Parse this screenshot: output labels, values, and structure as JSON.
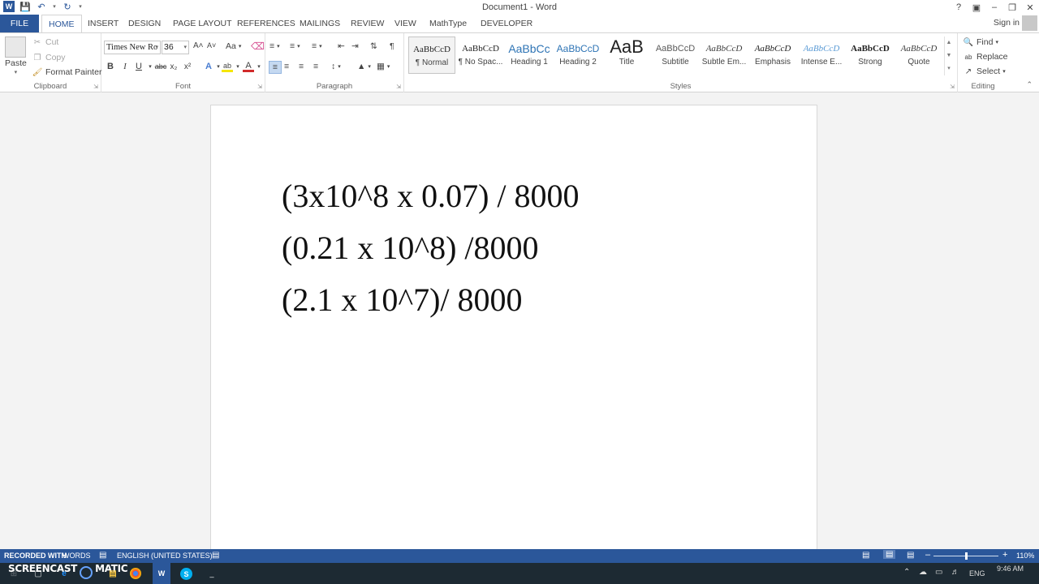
{
  "window": {
    "title": "Document1 - Word",
    "sign_in": "Sign in"
  },
  "tabs": [
    {
      "label": "FILE"
    },
    {
      "label": "HOME"
    },
    {
      "label": "INSERT"
    },
    {
      "label": "DESIGN"
    },
    {
      "label": "PAGE LAYOUT"
    },
    {
      "label": "REFERENCES"
    },
    {
      "label": "MAILINGS"
    },
    {
      "label": "REVIEW"
    },
    {
      "label": "VIEW"
    },
    {
      "label": "MathType"
    },
    {
      "label": "DEVELOPER"
    }
  ],
  "clipboard": {
    "paste": "Paste",
    "cut": "Cut",
    "copy": "Copy",
    "format_painter": "Format Painter",
    "label": "Clipboard"
  },
  "font": {
    "name": "Times New Ro",
    "size": "36",
    "label": "Font",
    "bold": "B",
    "italic": "I",
    "underline": "U",
    "strike": "abc",
    "subscript": "x₂",
    "superscript": "x²",
    "grow": "A˄",
    "shrink": "A˅",
    "case": "Aa",
    "effects": "A",
    "highlight": "ab",
    "color": "A"
  },
  "paragraph": {
    "label": "Paragraph",
    "pilcrow": "¶"
  },
  "styles": {
    "label": "Styles",
    "items": [
      {
        "preview": "AaBbCcD",
        "name": "¶ Normal"
      },
      {
        "preview": "AaBbCcD",
        "name": "¶ No Spac..."
      },
      {
        "preview": "AaBbCc",
        "name": "Heading 1"
      },
      {
        "preview": "AaBbCcD",
        "name": "Heading 2"
      },
      {
        "preview": "AaB",
        "name": "Title"
      },
      {
        "preview": "AaBbCcD",
        "name": "Subtitle"
      },
      {
        "preview": "AaBbCcD",
        "name": "Subtle Em..."
      },
      {
        "preview": "AaBbCcD",
        "name": "Emphasis"
      },
      {
        "preview": "AaBbCcD",
        "name": "Intense E..."
      },
      {
        "preview": "AaBbCcD",
        "name": "Strong"
      },
      {
        "preview": "AaBbCcD",
        "name": "Quote"
      }
    ]
  },
  "editing": {
    "label": "Editing",
    "find": "Find",
    "replace": "Replace",
    "select": "Select"
  },
  "document": {
    "lines": [
      "(3x10^8 x 0.07) / 8000",
      "(0.21 x 10^8) /8000",
      "(2.1 x 10^7)/ 8000"
    ]
  },
  "status": {
    "recorded_with": "RECORDED WITH",
    "words": "WORDS",
    "language": "ENGLISH (UNITED STATES)",
    "zoom": "110%"
  },
  "taskbar": {
    "watermark": "SCREENCAST",
    "watermark2": "MATIC",
    "lang": "ENG",
    "time": "9:46 AM"
  },
  "colors": {
    "accent": "#2b579a"
  }
}
